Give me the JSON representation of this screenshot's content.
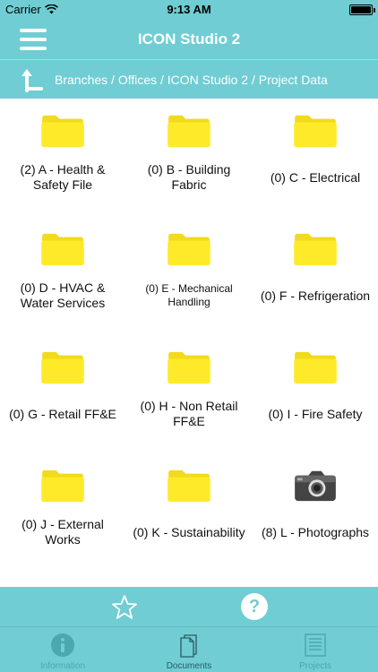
{
  "status_bar": {
    "carrier": "Carrier",
    "time": "9:13 AM"
  },
  "nav": {
    "title": "ICON Studio 2"
  },
  "breadcrumb": {
    "path": "Branches / Offices / ICON Studio 2 / Project Data"
  },
  "folders": [
    {
      "label": "(2) A - Health & Safety File",
      "icon": "folder-icon"
    },
    {
      "label": "(0) B - Building Fabric",
      "icon": "folder-icon"
    },
    {
      "label": "(0) C - Electrical",
      "icon": "folder-icon"
    },
    {
      "label": "(0) D - HVAC & Water Services",
      "icon": "folder-icon"
    },
    {
      "label": "(0) E - Mechanical Handling",
      "icon": "folder-icon"
    },
    {
      "label": "(0) F - Refrigeration",
      "icon": "folder-icon"
    },
    {
      "label": "(0) G - Retail FF&E",
      "icon": "folder-icon"
    },
    {
      "label": "(0) H - Non Retail FF&E",
      "icon": "folder-icon"
    },
    {
      "label": "(0) I - Fire Safety",
      "icon": "folder-icon"
    },
    {
      "label": "(0) J - External Works",
      "icon": "folder-icon"
    },
    {
      "label": "(0) K - Sustainability",
      "icon": "folder-icon"
    },
    {
      "label": "(8) L - Photographs",
      "icon": "camera-icon"
    }
  ],
  "action_bar": {
    "help_glyph": "?"
  },
  "tabs": [
    {
      "label": "Information",
      "icon": "info-icon",
      "active": false
    },
    {
      "label": "Documents",
      "icon": "documents-icon",
      "active": true
    },
    {
      "label": "Projects",
      "icon": "projects-list-icon",
      "active": false
    }
  ],
  "colors": {
    "accent": "#6fcdd3",
    "folder": "#ffea2a",
    "text": "#111111"
  }
}
